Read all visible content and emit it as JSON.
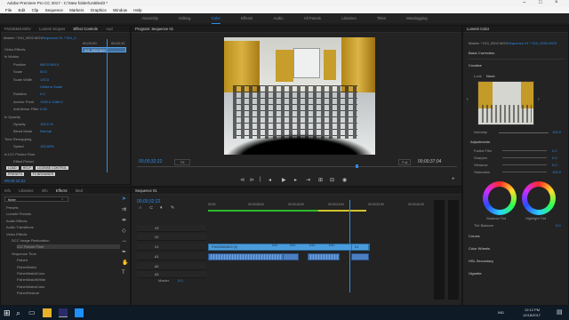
{
  "window": {
    "title": "Adobe Premiere Pro CC 2017 - C:\\New folder\\Untitled3 *"
  },
  "menu": [
    "File",
    "Edit",
    "Clip",
    "Sequence",
    "Markers",
    "Graphics",
    "Window",
    "Help"
  ],
  "workspaces": [
    {
      "label": "Assembly",
      "on": false
    },
    {
      "label": "Editing",
      "on": false
    },
    {
      "label": "Color",
      "on": true
    },
    {
      "label": "Effects",
      "on": false
    },
    {
      "label": "Audio",
      "on": false
    },
    {
      "label": "All Panels",
      "on": false
    },
    {
      "label": "Libraries",
      "on": false
    },
    {
      "label": "Titles",
      "on": false
    },
    {
      "label": "Metalogging",
      "on": false
    }
  ],
  "effect_controls": {
    "tabs": [
      "P1020363.MOV",
      "Lumetri Scopes",
      "Effect Controls",
      "Aud"
    ],
    "master": "Master * 010_0002.MOV",
    "seq": "Sequence 01 * 010_0...",
    "time_a": "00;00;00",
    "time_b": "00;00;32",
    "clip": "010_0002.MOV",
    "rows": [
      {
        "label": "Video Effects",
        "v": ""
      },
      {
        "label": "fx  Motion",
        "v": ""
      },
      {
        "label": "Position",
        "v": "960.0   540.0"
      },
      {
        "label": "Scale",
        "v": "50.0"
      },
      {
        "label": "Scale Width",
        "v": "100.0"
      },
      {
        "label": "",
        "v": "Uniform Scale"
      },
      {
        "label": "Rotation",
        "v": "0.0"
      },
      {
        "label": "Anchor Point",
        "v": "1920.0   1080.0"
      },
      {
        "label": "Anti-flicker Filter",
        "v": "0.00"
      },
      {
        "label": "fx  Opacity",
        "v": ""
      },
      {
        "label": "Opacity",
        "v": "100.0 %"
      },
      {
        "label": "Blend Mode",
        "v": "Normal"
      },
      {
        "label": "Time Remapping",
        "v": ""
      },
      {
        "label": "Speed",
        "v": "100.00%"
      },
      {
        "label": "fx  ICC Picture Fixer",
        "v": ""
      },
      {
        "label": "Effect Preset",
        "v": ""
      }
    ],
    "buttons": [
      "LOAD",
      "HELP",
      "LICENSE CONTROL"
    ],
    "buttons2": [
      "PRESETS",
      "FX BROWSER"
    ],
    "time": "00;00;32;22"
  },
  "program": {
    "tab": "Program: Sequence 01",
    "timecode": "00;00;32;22",
    "fit": "Fit",
    "full": "Full",
    "duration": "00;00;37;04"
  },
  "effects": {
    "tabs": [
      "Info",
      "Libraries",
      "Info",
      "Effects",
      "Med"
    ],
    "search": "fisher",
    "items": [
      "Presets",
      "Lumetri Presets",
      "Audio Effects",
      "Audio Transitions",
      "Video Effects",
      "DCC Image Restoration",
      "ICC Picture Fixer",
      "Sequence Time",
      "FisherI",
      "FisherMatch",
      "FisherMatchColor",
      "FisherMatchWhite",
      "FisherMatchColor",
      "FisherRestore"
    ]
  },
  "timeline": {
    "tab": "Sequence 01",
    "timecode": "00;00;32;22",
    "ruler": [
      "00;00",
      "00;00;08;00",
      "00;00;16;00",
      "00;00;24;00",
      "00;00;32;00",
      "00;00;40;00"
    ],
    "tracks": [
      {
        "h": "V3"
      },
      {
        "h": "V2"
      },
      {
        "h": "V1"
      },
      {
        "h": "A1"
      },
      {
        "h": "A2"
      },
      {
        "h": "A3"
      }
    ],
    "master": "Master",
    "master_val": "0.0",
    "clips": [
      "P1020363.MOV [V]",
      "D1C",
      "D1C",
      "D1C",
      "D1C",
      "D1"
    ]
  },
  "lumetri": {
    "tab": "Lumetri Color",
    "master": "Master * 010_0002.MOV",
    "seq": "Sequence 01 * 010_0002.MOV",
    "sections": [
      "Basic Correction",
      "Creative",
      "Curves",
      "Color Wheels",
      "HSL Secondary",
      "Vignette"
    ],
    "look_label": "Look",
    "look": "None",
    "intensity_label": "Intensity",
    "intensity": "100.0",
    "adjustments": "Adjustments",
    "sliders": [
      {
        "label": "Faded Film",
        "v": "0.0"
      },
      {
        "label": "Sharpen",
        "v": "0.0"
      },
      {
        "label": "Vibrance",
        "v": "0.0"
      },
      {
        "label": "Saturation",
        "v": "100.0"
      }
    ],
    "shadow": "Shadow Tint",
    "highlight": "Highlight Tint",
    "tint_label": "Tint Balance",
    "tint": "0.0"
  },
  "taskbar": {
    "lang": "IND",
    "time": "12:12 PM",
    "date": "12/18/2017"
  }
}
